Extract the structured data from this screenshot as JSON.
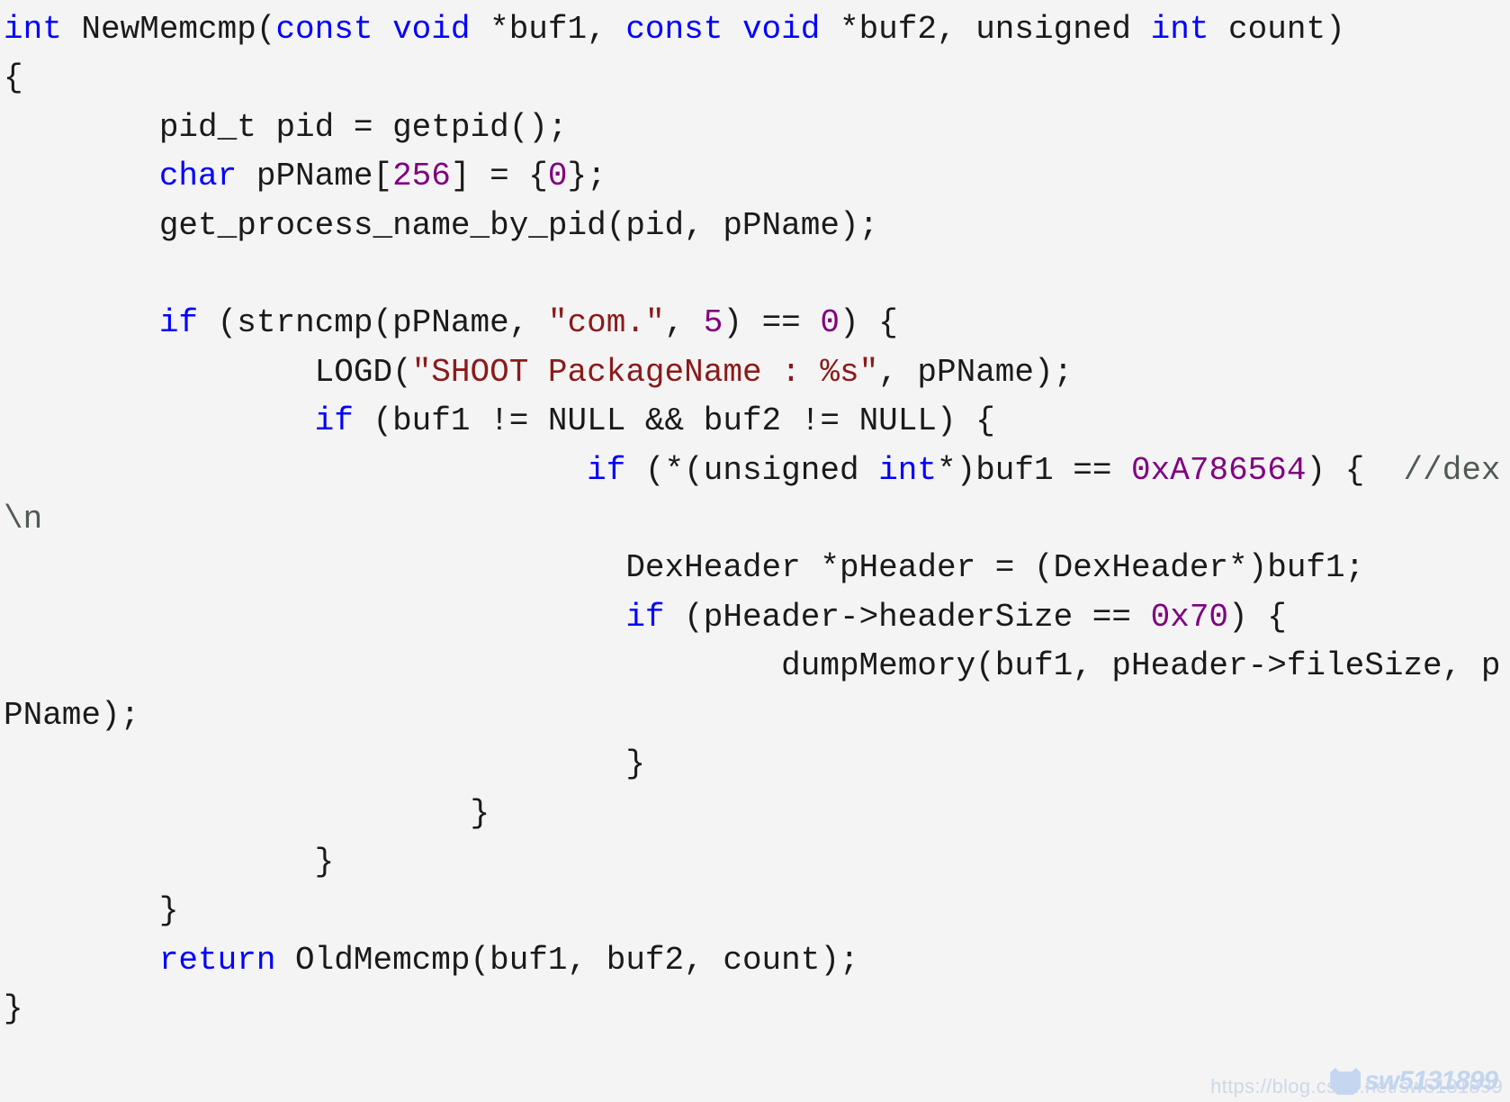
{
  "editor": {
    "language": "c",
    "background_color": "#f4f4f4",
    "default_text_color": "#1a1a1a",
    "syntax_colors": {
      "keyword": "#0000ff",
      "number": "#800080",
      "string": "#8b1a1a",
      "comment": "#4f5b52",
      "plain": "#1a1a1a"
    },
    "code_lines": [
      {
        "id": "line-1",
        "tokens": [
          {
            "t": "int",
            "c": "kw"
          },
          {
            "t": " NewMemcmp(",
            "c": "txt"
          },
          {
            "t": "const void",
            "c": "kw"
          },
          {
            "t": " *buf1, ",
            "c": "txt"
          },
          {
            "t": "const void",
            "c": "kw"
          },
          {
            "t": " *buf2, unsigned ",
            "c": "txt"
          },
          {
            "t": "int",
            "c": "kw"
          },
          {
            "t": " count)",
            "c": "txt"
          }
        ]
      },
      {
        "id": "line-2",
        "tokens": [
          {
            "t": "{",
            "c": "txt"
          }
        ]
      },
      {
        "id": "line-3",
        "tokens": [
          {
            "t": "        pid_t pid = getpid();",
            "c": "txt"
          }
        ]
      },
      {
        "id": "line-4",
        "tokens": [
          {
            "t": "        ",
            "c": "txt"
          },
          {
            "t": "char",
            "c": "kw"
          },
          {
            "t": " pPName[",
            "c": "txt"
          },
          {
            "t": "256",
            "c": "num"
          },
          {
            "t": "] = {",
            "c": "txt"
          },
          {
            "t": "0",
            "c": "num"
          },
          {
            "t": "};",
            "c": "txt"
          }
        ]
      },
      {
        "id": "line-5",
        "tokens": [
          {
            "t": "        get_process_name_by_pid(pid, pPName);",
            "c": "txt"
          }
        ]
      },
      {
        "id": "line-6",
        "tokens": [
          {
            "t": "",
            "c": "txt"
          }
        ]
      },
      {
        "id": "line-7",
        "tokens": [
          {
            "t": "        ",
            "c": "txt"
          },
          {
            "t": "if",
            "c": "kw"
          },
          {
            "t": " (strncmp(pPName, ",
            "c": "txt"
          },
          {
            "t": "\"com.\"",
            "c": "str"
          },
          {
            "t": ", ",
            "c": "txt"
          },
          {
            "t": "5",
            "c": "num"
          },
          {
            "t": ") == ",
            "c": "txt"
          },
          {
            "t": "0",
            "c": "num"
          },
          {
            "t": ") {",
            "c": "txt"
          }
        ]
      },
      {
        "id": "line-8",
        "tokens": [
          {
            "t": "                LOGD(",
            "c": "txt"
          },
          {
            "t": "\"SHOOT PackageName : %s\"",
            "c": "str"
          },
          {
            "t": ", pPName);",
            "c": "txt"
          }
        ]
      },
      {
        "id": "line-9",
        "tokens": [
          {
            "t": "                ",
            "c": "txt"
          },
          {
            "t": "if",
            "c": "kw"
          },
          {
            "t": " (buf1 != NULL && buf2 != NULL) {",
            "c": "txt"
          }
        ]
      },
      {
        "id": "line-10",
        "tokens": [
          {
            "t": "                              ",
            "c": "txt"
          },
          {
            "t": "if",
            "c": "kw"
          },
          {
            "t": " (*(unsigned ",
            "c": "txt"
          },
          {
            "t": "int",
            "c": "kw"
          },
          {
            "t": "*)buf1 == ",
            "c": "txt"
          },
          {
            "t": "0xA786564",
            "c": "num"
          },
          {
            "t": ") {  ",
            "c": "txt"
          },
          {
            "t": "//dex\\n",
            "c": "cmt"
          }
        ]
      },
      {
        "id": "line-11",
        "tokens": [
          {
            "t": "                                DexHeader *pHeader = (DexHeader*)buf1;",
            "c": "txt"
          }
        ]
      },
      {
        "id": "line-12",
        "tokens": [
          {
            "t": "                                ",
            "c": "txt"
          },
          {
            "t": "if",
            "c": "kw"
          },
          {
            "t": " (pHeader->headerSize == ",
            "c": "txt"
          },
          {
            "t": "0x70",
            "c": "num"
          },
          {
            "t": ") {",
            "c": "txt"
          }
        ]
      },
      {
        "id": "line-13",
        "tokens": [
          {
            "t": "                                        dumpMemory(buf1, pHeader->fileSize, pPName);",
            "c": "txt"
          }
        ]
      },
      {
        "id": "line-14",
        "tokens": [
          {
            "t": "                                }",
            "c": "txt"
          }
        ]
      },
      {
        "id": "line-15",
        "tokens": [
          {
            "t": "                        }",
            "c": "txt"
          }
        ]
      },
      {
        "id": "line-16",
        "tokens": [
          {
            "t": "                }",
            "c": "txt"
          }
        ]
      },
      {
        "id": "line-17",
        "tokens": [
          {
            "t": "        }",
            "c": "txt"
          }
        ]
      },
      {
        "id": "line-18",
        "tokens": [
          {
            "t": "        ",
            "c": "txt"
          },
          {
            "t": "return",
            "c": "kw"
          },
          {
            "t": " OldMemcmp(buf1, buf2, count);",
            "c": "txt"
          }
        ]
      },
      {
        "id": "line-19",
        "tokens": [
          {
            "t": "}",
            "c": "txt"
          }
        ]
      }
    ]
  },
  "watermark": {
    "url": "https://blog.csdn.net/sw5131899",
    "brand": "sw5131899",
    "color": "#c2d5ef"
  }
}
